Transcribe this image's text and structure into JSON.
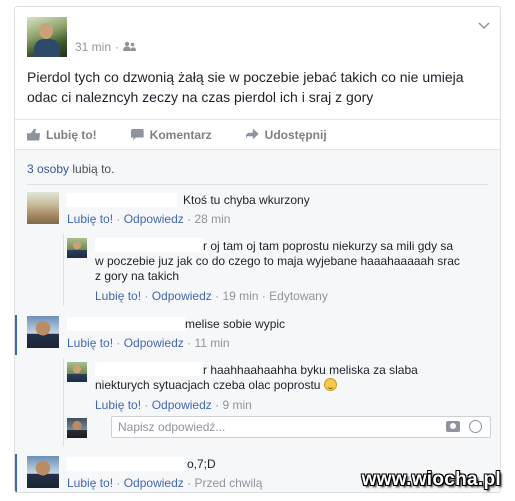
{
  "post": {
    "time": "31 min",
    "separator": "·",
    "text": "Pierdol tych co dzwonią żałą sie w poczebie jebać takich co nie umieja odac ci nalezncyh zeczy na czas pierdol ich i sraj z gory"
  },
  "actions": {
    "like": "Lubię to!",
    "comment": "Komentarz",
    "share": "Udostępnij"
  },
  "likes": {
    "count_text": "3 osoby",
    "suffix": "lubią to."
  },
  "comments": [
    {
      "text": "Ktoś tu chyba wkurzony",
      "like": "Lubię to!",
      "reply": "Odpowiedz",
      "time": "28 min"
    },
    {
      "text": "r oj tam oj tam poprostu niekurzy sa mili gdy sa w poczebie juz jak co do czego to maja wyjebane haaahaaaaah srac z gory na takich",
      "like": "Lubię to!",
      "reply": "Odpowiedz",
      "time": "19 min",
      "edited": "Edytowany"
    },
    {
      "text": "melise sobie wypic",
      "like": "Lubię to!",
      "reply": "Odpowiedz",
      "time": "11 min"
    },
    {
      "text": "r haahhaahaahha byku meliska za slaba niekturych sytuacjach czeba olac poprostu",
      "like": "Lubię to!",
      "reply": "Odpowiedz",
      "time": "9 min"
    },
    {
      "text": "o,7;D",
      "like": "Lubię to!",
      "reply": "Odpowiedz",
      "time": "Przed chwilą"
    }
  ],
  "reply_box": {
    "placeholder": "Napisz odpowiedź..."
  },
  "watermark": "www.wiocha.pl"
}
